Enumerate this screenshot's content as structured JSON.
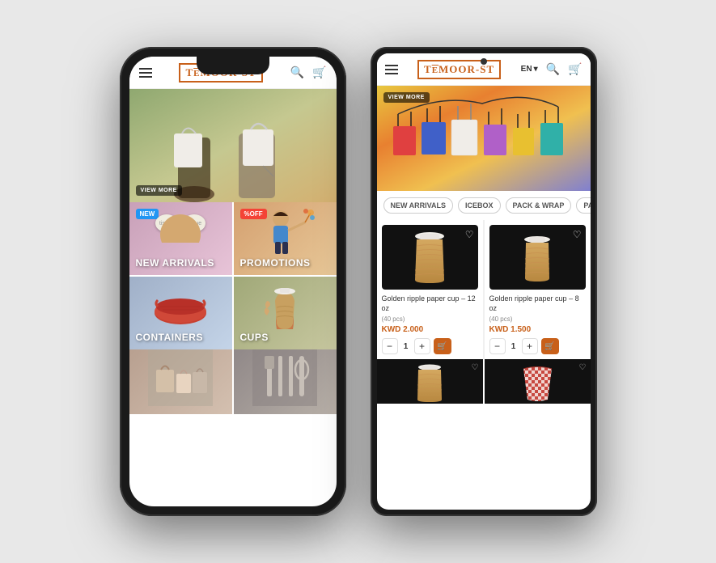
{
  "background": "#e0e0e0",
  "phone_left": {
    "header": {
      "logo": "TEMOOR-ST",
      "menu_icon": "menu",
      "search_icon": "search",
      "cart_icon": "cart"
    },
    "hero": {
      "view_more_label": "VIEW MORE"
    },
    "categories": [
      {
        "id": "new-arrivals",
        "label": "NEW ARRIVALS",
        "badge": "NEW",
        "badge_type": "new"
      },
      {
        "id": "promotions",
        "label": "PROMOTIONS",
        "badge": "%OFF",
        "badge_type": "off"
      },
      {
        "id": "containers",
        "label": "CONTAINERS",
        "badge": null
      },
      {
        "id": "cups",
        "label": "CUPS",
        "badge": null
      }
    ],
    "bottom_categories": [
      {
        "id": "bags",
        "label": ""
      },
      {
        "id": "utensils",
        "label": ""
      }
    ]
  },
  "phone_right": {
    "header": {
      "logo": "TEMOOR-ST",
      "menu_icon": "menu",
      "lang": "EN",
      "lang_chevron": "▾",
      "search_icon": "search",
      "cart_icon": "cart"
    },
    "hero": {
      "view_more_label": "VIEW MORE"
    },
    "filter_tabs": [
      {
        "id": "new-arrivals",
        "label": "NEW ARRIVALS",
        "active": false
      },
      {
        "id": "icebox",
        "label": "ICEBOX",
        "active": false
      },
      {
        "id": "pack-wrap",
        "label": "PACK & WRAP",
        "active": false
      },
      {
        "id": "party",
        "label": "PARTY",
        "active": false
      }
    ],
    "products": [
      {
        "id": "p1",
        "name": "Golden ripple paper cup – 12 oz",
        "qty_label": "(40 pcs)",
        "price": "KWD 2.000",
        "qty": "1",
        "cup_color": "#c8a060"
      },
      {
        "id": "p2",
        "name": "Golden ripple paper cup – 8 oz",
        "qty_label": "(40 pcs)",
        "price": "KWD 1.500",
        "qty": "1",
        "cup_color": "#c8a060"
      }
    ],
    "cart_btn_label": "🛒",
    "minus_label": "−",
    "plus_label": "+"
  }
}
